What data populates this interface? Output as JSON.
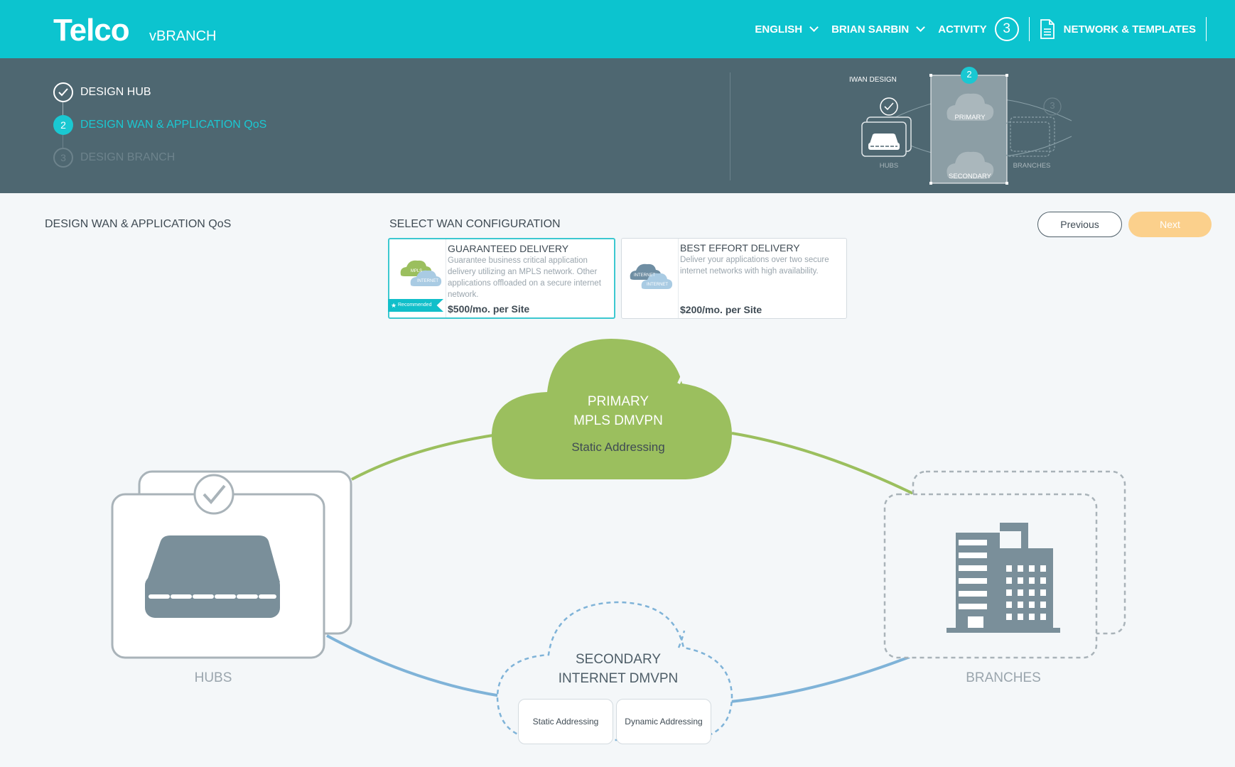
{
  "header": {
    "brand": "Telco",
    "product": "vBRANCH",
    "nav": {
      "language": "ENGLISH",
      "user": "BRIAN SARBIN",
      "activity_label": "ACTIVITY",
      "activity_count": "3",
      "network_label": "NETWORK & TEMPLATES"
    }
  },
  "steps": [
    {
      "number": "✓",
      "label": "DESIGN HUB",
      "state": "done"
    },
    {
      "number": "2",
      "label": "DESIGN WAN & APPLICATION QoS",
      "state": "active"
    },
    {
      "number": "3",
      "label": "DESIGN BRANCH",
      "state": "future"
    }
  ],
  "mini_map": {
    "title": "IWAN DESIGN",
    "active_step": "2",
    "hubs_label": "HUBS",
    "primary_label": "PRIMARY",
    "secondary_label": "SECONDARY",
    "branches_label": "BRANCHES",
    "branches_step": "3"
  },
  "main": {
    "title": "DESIGN WAN & APPLICATION QoS",
    "select_title": "SELECT WAN CONFIGURATION",
    "previous_label": "Previous",
    "next_label": "Next"
  },
  "options": [
    {
      "title": "GUARANTEED DELIVERY",
      "description": "Guarantee business critical application delivery utilizing an MPLS network. Other applications offloaded on a secure internet network.",
      "price": "$500/mo. per Site",
      "badge": "Recommended",
      "thumb_cloud_1": "MPLS",
      "thumb_cloud_2": "INTERNET",
      "selected": true
    },
    {
      "title": "BEST EFFORT DELIVERY",
      "description": "Deliver your applications over two secure internet networks with high availability.",
      "price": "$200/mo. per Site",
      "thumb_cloud_1": "INTERNET",
      "thumb_cloud_2": "INTERNET",
      "selected": false
    }
  ],
  "diagram": {
    "primary": {
      "line1": "PRIMARY",
      "line2": "MPLS DMVPN",
      "addressing": "Static Addressing"
    },
    "secondary": {
      "line1": "SECONDARY",
      "line2": "INTERNET DMVPN",
      "addr_static": "Static Addressing",
      "addr_dynamic": "Dynamic Addressing"
    },
    "hubs_label": "HUBS",
    "branches_label": "BRANCHES"
  },
  "colors": {
    "topbar": "#0cc4cf",
    "stepbar": "#4e6771",
    "accent": "#1ac8d2",
    "primary_cloud": "#9bbf5e",
    "secondary_line": "#7fb3d8",
    "device": "#7a8f9a",
    "next_button": "#fbd08c"
  }
}
